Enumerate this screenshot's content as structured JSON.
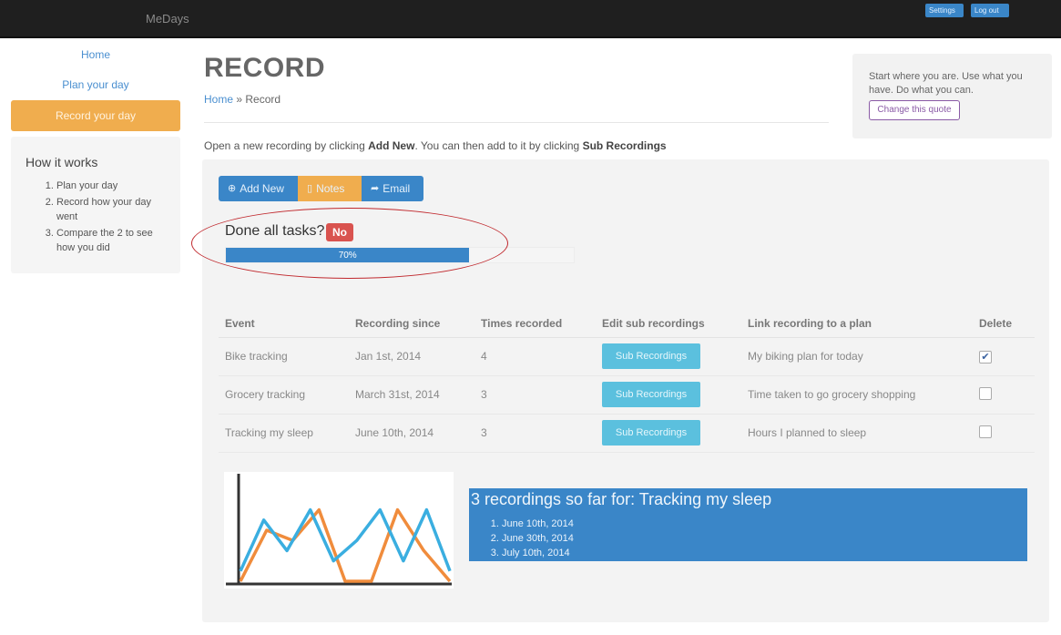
{
  "navbar": {
    "brand": "MeDays",
    "settings_label": "Settings",
    "logout_label": "Log out"
  },
  "sidebar": {
    "items": [
      {
        "label": "Home"
      },
      {
        "label": "Plan your day"
      },
      {
        "label": "Record your day"
      }
    ],
    "how_it_works": {
      "title": "How it works",
      "steps": [
        "Plan your day",
        "Record how your day went",
        "Compare the 2 to see how you did"
      ]
    }
  },
  "header": {
    "title": "RECORD",
    "breadcrumb_home": "Home",
    "breadcrumb_sep": "»",
    "breadcrumb_current": "Record",
    "intro_prefix": "Open a new recording by clicking ",
    "intro_add": "Add New",
    "intro_middle": ". You can then add to it by clicking ",
    "intro_sub": "Sub Recordings"
  },
  "quote": {
    "text": "Start where you are. Use what you have. Do what you can.",
    "button_label": "Change this quote"
  },
  "toolbar": {
    "add_label": "Add New",
    "notes_label": "Notes",
    "email_label": "Email"
  },
  "status": {
    "done_label": "Done all tasks?",
    "badge": "No",
    "progress": 0.7,
    "progress_label": "70%"
  },
  "table": {
    "headers": [
      "Event",
      "Recording since",
      "Times recorded",
      "Edit sub recordings",
      "Link recording to a plan",
      "Delete"
    ],
    "rows": [
      {
        "event": "Bike tracking",
        "since": "Jan 1st, 2014",
        "times": "4",
        "sub": "Sub Recordings",
        "plan": "My biking plan for today",
        "checked": true
      },
      {
        "event": "Grocery tracking",
        "since": "March 31st, 2014",
        "times": "3",
        "sub": "Sub Recordings",
        "plan": "Time taken to go grocery shopping",
        "checked": false
      },
      {
        "event": "Tracking my sleep",
        "since": "June 10th, 2014",
        "times": "3",
        "sub": "Sub Recordings",
        "plan": "Hours I planned to sleep",
        "checked": false
      }
    ]
  },
  "recordings": {
    "title": "3 recordings so far for: Tracking my sleep",
    "items": [
      "June 10th, 2014",
      "June 30th, 2014",
      "July 10th, 2014"
    ]
  },
  "chart_data": {
    "type": "line",
    "series": [
      {
        "values": [
          0,
          5,
          4,
          7,
          0,
          0,
          7,
          3,
          0
        ]
      },
      {
        "values": [
          1,
          6,
          3,
          7,
          2,
          4,
          7,
          2,
          7,
          1
        ]
      }
    ],
    "colors": [
      "#f08c3c",
      "#3aaee0"
    ],
    "ylim": [
      0,
      10
    ],
    "grid": false
  }
}
